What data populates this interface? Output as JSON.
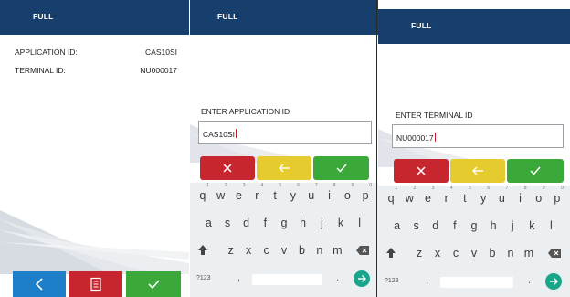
{
  "colors": {
    "header": "#173f6e",
    "blue": "#1d7fc8",
    "red": "#c8262f",
    "yellow": "#e6cb2e",
    "green": "#3aa93a",
    "keyboard_bg": "#eceff1",
    "go_key": "#1aa68a"
  },
  "screens": [
    {
      "header_title": "FULL",
      "rows": [
        {
          "label": "APPLICATION ID:",
          "value": "CAS10SI"
        },
        {
          "label": "TERMINAL ID:",
          "value": "NU000017"
        }
      ],
      "bottom_buttons": [
        {
          "icon": "chevron-left-icon",
          "color": "blue"
        },
        {
          "icon": "receipt-icon",
          "color": "red"
        },
        {
          "icon": "checkmark-icon",
          "color": "green"
        }
      ]
    },
    {
      "header_title": "FULL",
      "prompt": "ENTER APPLICATION ID",
      "input_value": "CAS10SI"
    },
    {
      "header_title": "FULL",
      "prompt": "ENTER TERMINAL ID",
      "input_value": "NU000017"
    }
  ],
  "action_buttons": [
    {
      "icon": "cancel-x-icon",
      "color": "red"
    },
    {
      "icon": "backspace-arrow-icon",
      "color": "yellow"
    },
    {
      "icon": "confirm-check-icon",
      "color": "green"
    }
  ],
  "keyboard": {
    "row1": [
      {
        "k": "q",
        "h": "1"
      },
      {
        "k": "w",
        "h": "2"
      },
      {
        "k": "e",
        "h": "3"
      },
      {
        "k": "r",
        "h": "4"
      },
      {
        "k": "t",
        "h": "5"
      },
      {
        "k": "y",
        "h": "6"
      },
      {
        "k": "u",
        "h": "7"
      },
      {
        "k": "i",
        "h": "8"
      },
      {
        "k": "o",
        "h": "9"
      },
      {
        "k": "p",
        "h": "0"
      }
    ],
    "row2": [
      "a",
      "s",
      "d",
      "f",
      "g",
      "h",
      "j",
      "k",
      "l"
    ],
    "row3": [
      "z",
      "x",
      "c",
      "v",
      "b",
      "n",
      "m"
    ],
    "symbols_label": "?123",
    "comma": ",",
    "period": "."
  }
}
